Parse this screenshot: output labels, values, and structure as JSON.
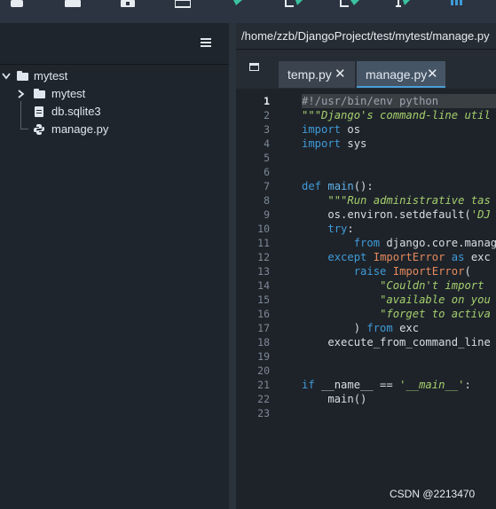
{
  "toolbar": {
    "icons": [
      "save-icon",
      "folder-icon",
      "archive-icon",
      "copy-icon",
      "run-icon",
      "run-current-icon",
      "run-all-icon",
      "step-icon",
      "debug-icon"
    ]
  },
  "sidebar": {
    "menu_icon": "hamburger-menu-icon",
    "tree": [
      {
        "label": "mytest",
        "type": "folder",
        "expanded": true
      },
      {
        "label": "mytest",
        "type": "folder",
        "expanded": false
      },
      {
        "label": "db.sqlite3",
        "type": "file"
      },
      {
        "label": "manage.py",
        "type": "python"
      }
    ]
  },
  "editor": {
    "path": "/home/zzb/DjangoProject/test/mytest/manage.py",
    "tabs": [
      {
        "label": "temp.py",
        "active": false,
        "close": "✕"
      },
      {
        "label": "manage.py",
        "active": true,
        "close": "✕"
      }
    ],
    "current_line": 1,
    "line_numbers": [
      "1",
      "2",
      "3",
      "4",
      "5",
      "6",
      "7",
      "8",
      "9",
      "10",
      "11",
      "12",
      "13",
      "14",
      "15",
      "16",
      "17",
      "18",
      "19",
      "20",
      "21",
      "22",
      "23"
    ],
    "code": [
      "#!/usr/bin/env python",
      "\"\"\"Django's command-line util",
      "import os",
      "import sys",
      "",
      "",
      "def main():",
      "    \"\"\"Run administrative tas",
      "    os.environ.setdefault('DJ",
      "    try:",
      "        from django.core.manag",
      "    except ImportError as exc",
      "        raise ImportError(",
      "            \"Couldn't import ",
      "            \"available on you",
      "            \"forget to activa",
      "        ) from exc",
      "    execute_from_command_line",
      "",
      "",
      "if __name__ == '__main__':",
      "    main()",
      ""
    ]
  },
  "watermark": "CSDN @2213470",
  "colors": {
    "accent": "#4b9dd6",
    "keyword": "#3f9bd8",
    "string": "#a5cf6c",
    "class": "#e58a5c"
  }
}
